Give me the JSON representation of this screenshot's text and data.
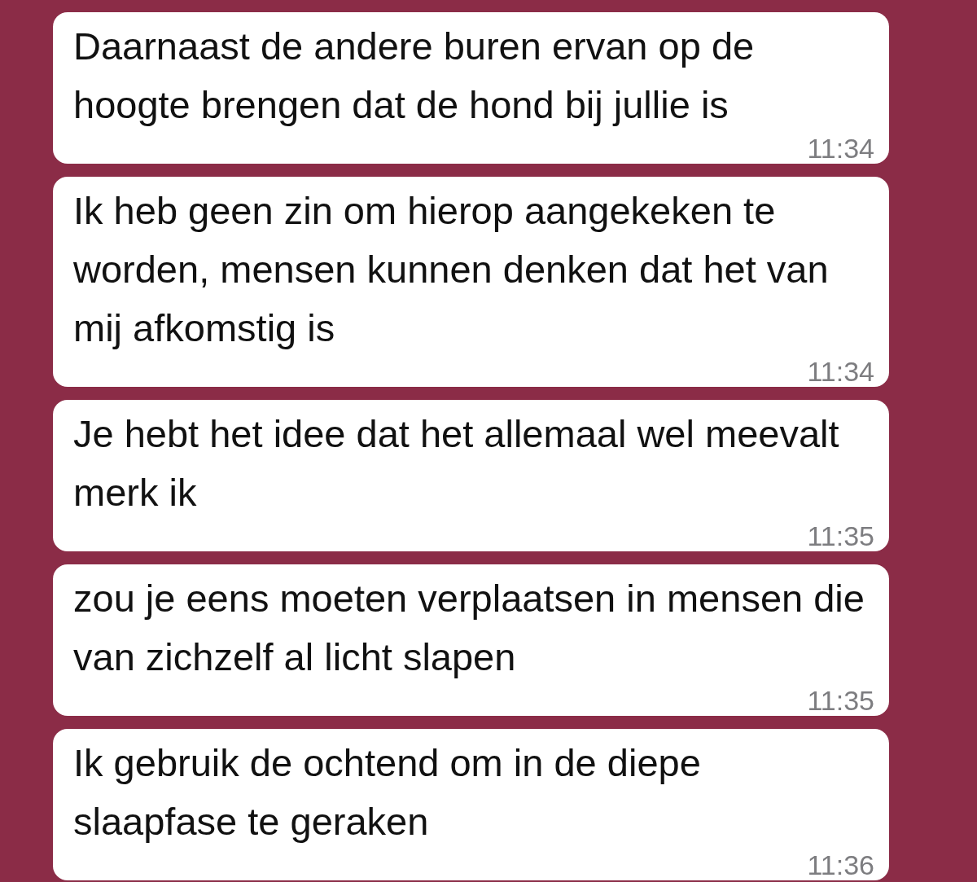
{
  "messages": [
    {
      "text": "Daarnaast de andere buren ervan op de hoogte brengen dat de hond bij jullie is",
      "time": "11:34"
    },
    {
      "text": "Ik heb geen zin om hierop aangekeken te worden, mensen kunnen denken dat het van mij afkomstig is",
      "time": "11:34"
    },
    {
      "text": "Je hebt het idee dat het allemaal wel meevalt merk ik",
      "time": "11:35"
    },
    {
      "text": "zou je eens moeten verplaatsen in mensen die van zichzelf al licht slapen",
      "time": "11:35"
    },
    {
      "text": "Ik gebruik de ochtend om in de diepe slaapfase te geraken",
      "time": "11:36"
    }
  ]
}
